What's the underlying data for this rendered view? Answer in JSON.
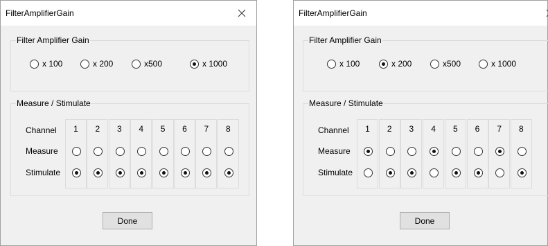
{
  "dialogs": [
    {
      "title": "FilterAmplifierGain",
      "gain_group_label": "Filter Amplifier Gain",
      "gain_options": [
        "x 100",
        "x 200",
        "x500",
        "x 1000"
      ],
      "gain_selected": 3,
      "measure_group_label": "Measure / Stimulate",
      "row_labels": {
        "channel": "Channel",
        "measure": "Measure",
        "stimulate": "Stimulate"
      },
      "channels": [
        "1",
        "2",
        "3",
        "4",
        "5",
        "6",
        "7",
        "8"
      ],
      "channel_modes": [
        "stimulate",
        "stimulate",
        "stimulate",
        "stimulate",
        "stimulate",
        "stimulate",
        "stimulate",
        "stimulate"
      ],
      "done_label": "Done"
    },
    {
      "title": "FilterAmplifierGain",
      "gain_group_label": "Filter Amplifier Gain",
      "gain_options": [
        "x 100",
        "x 200",
        "x500",
        "x 1000"
      ],
      "gain_selected": 1,
      "measure_group_label": "Measure / Stimulate",
      "row_labels": {
        "channel": "Channel",
        "measure": "Measure",
        "stimulate": "Stimulate"
      },
      "channels": [
        "1",
        "2",
        "3",
        "4",
        "5",
        "6",
        "7",
        "8"
      ],
      "channel_modes": [
        "measure",
        "stimulate",
        "stimulate",
        "measure",
        "stimulate",
        "stimulate",
        "measure",
        "stimulate"
      ],
      "done_label": "Done"
    }
  ],
  "icons": {
    "close": "close-icon"
  }
}
